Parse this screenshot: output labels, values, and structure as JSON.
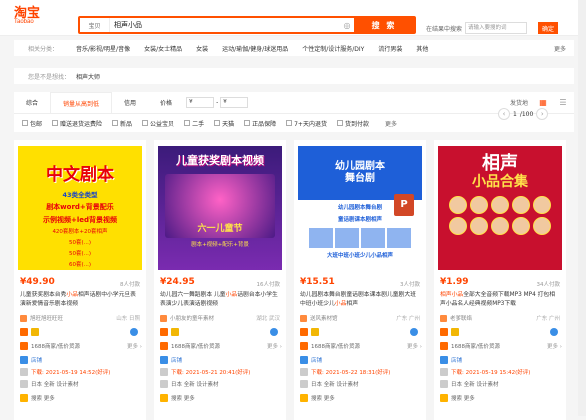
{
  "header": {
    "logo": "淘宝",
    "logo_sub": "Taobao",
    "search_category": "宝贝",
    "search_query": "相声小品",
    "search_button": "搜 索",
    "shop_search_label": "在结果中搜索",
    "shop_search_placeholder": "请输入要搜的词",
    "shop_search_button": "确定"
  },
  "category_row": {
    "key": "相关分类：",
    "items": [
      "音乐/影视/明星/音像",
      "女装/女士精品",
      "女装",
      "运动/瑜伽/健身/球迷用品",
      "个性定制/设计服务/DIY",
      "流行男装",
      "其他"
    ],
    "more": "更多"
  },
  "filter_row": {
    "key": "您是不是想找：",
    "value": "相声大师"
  },
  "sort_bar": {
    "items": [
      "综合",
      "销量从高到低",
      "信用",
      "价格"
    ],
    "price_from": "¥",
    "price_to": "¥",
    "ship": "发货地"
  },
  "checks": [
    "包邮",
    "赠送退货运费险",
    "新品",
    "公益宝贝",
    "二手",
    "天猫",
    "正品保障",
    "7+天内退货",
    "货到付款"
  ],
  "checks_more": "更多",
  "pager": {
    "current": "1",
    "total": "/100"
  },
  "cards": [
    {
      "img_text": [
        "中文剧本",
        "43类全类型",
        "剧本word+背景配乐",
        "示例视频+led背景视频",
        "420套剧本+20套相声",
        "50套(...)",
        "50套(...)",
        "60套(...)"
      ],
      "price": "¥49.90",
      "sales": "8人付款",
      "title_pre": "儿童获奖剧本台秀",
      "title_hl": "小品",
      "title_post": "相声话剧中小学元旦表演",
      "title2": "新爱情音乐剧本视频",
      "shop": "旭旺旭旺旺旺",
      "loc": "山东 日照",
      "row1": "1688商家/低价货源",
      "row2": "店铺: 更多",
      "row3_l": "店铺",
      "row3_r": "2021-05-19 14:52(好评)",
      "row4": "下载: 2021-05-19 14:52(好评)",
      "row5": "日本 全新 设计素材",
      "row6": "搜索 更多"
    },
    {
      "img_text": [
        "儿童获奖剧本视频",
        "六一儿童节",
        "剧本+视频+配乐+背景"
      ],
      "price": "¥24.95",
      "sales": "16人付款",
      "title_pre": "幼儿园六一舞蹈剧本 儿童",
      "title_hl": "小品",
      "title_post": "话剧台本",
      "title2": "小学生表演少儿表演话剧视频",
      "shop": "小朋友的童年素材",
      "loc": "湖北 武汉",
      "row1": "1688商家/低价货源",
      "row2": "店铺: 更多",
      "row3_l": "店铺",
      "row3_r": "2021-05-21 20:41(好评)",
      "row4": "下载: 2021-05-21 20:41(好评)",
      "row5": "日本 全新 设计素材",
      "row6": "搜索 更多"
    },
    {
      "img_text": [
        "幼儿园剧本",
        "舞台剧",
        "幼儿园剧本舞台剧",
        "童话剧课本剧相声",
        "大班中班小班少儿小品相声"
      ],
      "price": "¥15.51",
      "sales": "3人付款",
      "title_pre": "幼儿园剧本舞台剧童话剧本课本剧儿童剧大班中班小班少儿",
      "title_hl": "小品",
      "title_post": "相声",
      "title2": "",
      "shop": "送风素材馆",
      "loc": "广东 广州",
      "row1": "1688商家/低价货源",
      "row2": "店铺: 更多",
      "row3_l": "店铺",
      "row3_r": "2021-05-22 18:31(好评)",
      "row4": "下载: 2021-05-22 18:31(好评)",
      "row5": "日本 全新 设计素材",
      "row6": "搜索 更多"
    },
    {
      "img_text": [
        "相声",
        "小品合集"
      ],
      "price": "¥1.99",
      "sales": "34人付款",
      "title_pre": "",
      "title_hl": "相声小品",
      "title_post": "全部大全音频下载MP3 MP4 打包相声",
      "title2": "小品名人经典视频MP3下载",
      "shop": "老爹联络",
      "loc": "广东 广州",
      "row1": "1688商家/低价货源",
      "row2": "店铺: 更多",
      "row3_l": "店铺",
      "row3_r": "2021-05-19 15:42(好评)",
      "row4": "下载: 2021-05-19 15:42(好评)",
      "row5": "日本 全新 设计素材",
      "row6": "搜索 更多"
    }
  ]
}
